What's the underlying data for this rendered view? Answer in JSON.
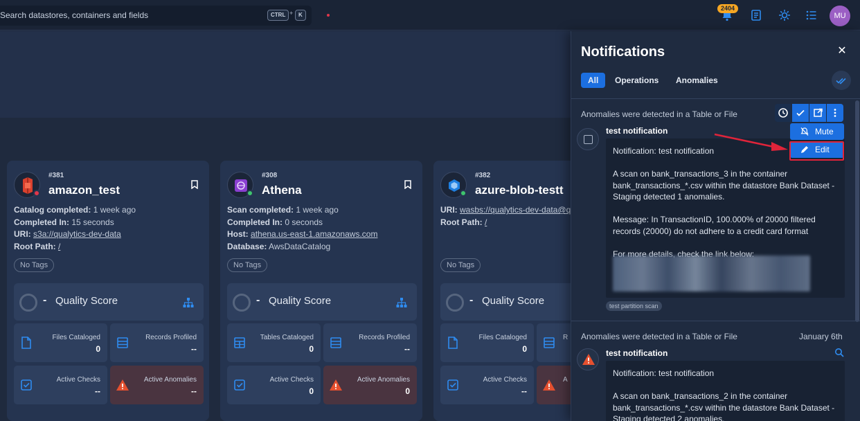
{
  "search": {
    "placeholder": "Search datastores, containers and fields",
    "shortcut_key1": "CTRL",
    "shortcut_plus": "+",
    "shortcut_key2": "K"
  },
  "header": {
    "notification_count": "2404",
    "avatar_initials": "MU"
  },
  "cards": [
    {
      "id": "#381",
      "name": "amazon_test",
      "status_color": "#e0364a",
      "meta": [
        {
          "label": "Catalog completed:",
          "value": "1 week ago",
          "link": false
        },
        {
          "label": "Completed In:",
          "value": "15 seconds",
          "link": false
        },
        {
          "label": "URI:",
          "value": "s3a://qualytics-dev-data",
          "link": true
        },
        {
          "label": "Root Path:",
          "value": "/",
          "link": true
        }
      ],
      "tag": "No Tags",
      "quality_dash": "-",
      "quality_label": "Quality Score",
      "stats": [
        {
          "label": "Files Cataloged",
          "value": "0"
        },
        {
          "label": "Records Profiled",
          "value": "--"
        },
        {
          "label": "Active Checks",
          "value": "--"
        },
        {
          "label": "Active Anomalies",
          "value": "--"
        }
      ]
    },
    {
      "id": "#308",
      "name": "Athena",
      "status_color": "#3ec46d",
      "meta": [
        {
          "label": "Scan completed:",
          "value": "1 week ago",
          "link": false
        },
        {
          "label": "Completed In:",
          "value": "0 seconds",
          "link": false
        },
        {
          "label": "Host:",
          "value": "athena.us-east-1.amazonaws.com",
          "link": true
        },
        {
          "label": "Database:",
          "value": "AwsDataCatalog",
          "link": false
        }
      ],
      "tag": "No Tags",
      "quality_dash": "-",
      "quality_label": "Quality Score",
      "stats": [
        {
          "label": "Tables Cataloged",
          "value": "0"
        },
        {
          "label": "Records Profiled",
          "value": "--"
        },
        {
          "label": "Active Checks",
          "value": "0"
        },
        {
          "label": "Active Anomalies",
          "value": "0"
        }
      ]
    },
    {
      "id": "#382",
      "name": "azure-blob-testt",
      "status_color": "#3ec46d",
      "meta": [
        {
          "label": "URI:",
          "value": "wasbs://qualytics-dev-data@q",
          "link": true
        },
        {
          "label": "Root Path:",
          "value": "/",
          "link": true
        }
      ],
      "tag": "No Tags",
      "quality_dash": "-",
      "quality_label": "Quality Score",
      "stats": [
        {
          "label": "Files Cataloged",
          "value": "0"
        },
        {
          "label": "R",
          "value": ""
        },
        {
          "label": "Active Checks",
          "value": "--"
        },
        {
          "label": "A",
          "value": ""
        }
      ]
    }
  ],
  "panel": {
    "title": "Notifications",
    "tabs": [
      "All",
      "Operations",
      "Anomalies"
    ],
    "notifications": [
      {
        "group": "Anomalies were detected in a Table or File",
        "date": "",
        "title": "test notification",
        "body": [
          "Notification: test notification",
          "A scan on bank_transactions_3 in the container bank_transactions_*.csv within the datastore Bank Dataset - Staging detected 1 anomalies.",
          "Message: In TransactionID, 100.000% of 20000 filtered records (20000) do not adhere to a credit card format",
          "For more details, check the link below:"
        ],
        "tag": "test partition scan"
      },
      {
        "group": "Anomalies were detected in a Table or File",
        "date": "January 6th",
        "title": "test notification",
        "body": [
          "Notification: test notification",
          "A scan on bank_transactions_2 in the container bank_transactions_*.csv within the datastore Bank Dataset - Staging detected 2 anomalies."
        ]
      }
    ],
    "menu": {
      "mute": "Mute",
      "edit": "Edit"
    }
  },
  "colors": {
    "accent": "#1c6fe0",
    "danger": "#e0364a",
    "warning": "#f5a623",
    "success": "#3ec46d"
  }
}
